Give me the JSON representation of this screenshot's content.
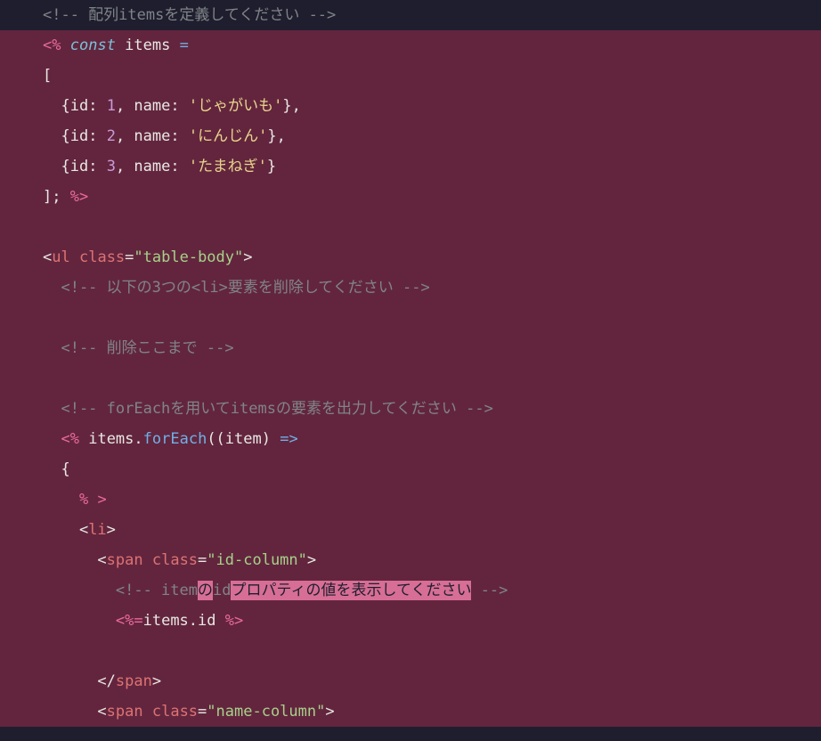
{
  "lines": [
    {
      "hl": false,
      "parts": [
        {
          "c": "tok-comment",
          "t": "<!-- 配列itemsを定義してください -->"
        }
      ]
    },
    {
      "hl": true,
      "parts": [
        {
          "c": "tok-delim",
          "t": "<%"
        },
        {
          "c": "tok-plain",
          "t": " "
        },
        {
          "c": "tok-keyword",
          "t": "const"
        },
        {
          "c": "tok-plain",
          "t": " "
        },
        {
          "c": "tok-var",
          "t": "items"
        },
        {
          "c": "tok-plain",
          "t": " "
        },
        {
          "c": "tok-blue",
          "t": "="
        }
      ]
    },
    {
      "hl": true,
      "parts": [
        {
          "c": "tok-plain",
          "t": "["
        }
      ]
    },
    {
      "hl": true,
      "parts": [
        {
          "c": "tok-plain",
          "t": "  {"
        },
        {
          "c": "tok-attr",
          "t": "id"
        },
        {
          "c": "tok-plain",
          "t": ": "
        },
        {
          "c": "tok-number",
          "t": "1"
        },
        {
          "c": "tok-plain",
          "t": ", "
        },
        {
          "c": "tok-attr",
          "t": "name"
        },
        {
          "c": "tok-plain",
          "t": ": "
        },
        {
          "c": "tok-string",
          "t": "'じゃがいも'"
        },
        {
          "c": "tok-plain",
          "t": "},"
        }
      ]
    },
    {
      "hl": true,
      "parts": [
        {
          "c": "tok-plain",
          "t": "  {"
        },
        {
          "c": "tok-attr",
          "t": "id"
        },
        {
          "c": "tok-plain",
          "t": ": "
        },
        {
          "c": "tok-number",
          "t": "2"
        },
        {
          "c": "tok-plain",
          "t": ", "
        },
        {
          "c": "tok-attr",
          "t": "name"
        },
        {
          "c": "tok-plain",
          "t": ": "
        },
        {
          "c": "tok-string",
          "t": "'にんじん'"
        },
        {
          "c": "tok-plain",
          "t": "},"
        }
      ]
    },
    {
      "hl": true,
      "parts": [
        {
          "c": "tok-plain",
          "t": "  {"
        },
        {
          "c": "tok-attr",
          "t": "id"
        },
        {
          "c": "tok-plain",
          "t": ": "
        },
        {
          "c": "tok-number",
          "t": "3"
        },
        {
          "c": "tok-plain",
          "t": ", "
        },
        {
          "c": "tok-attr",
          "t": "name"
        },
        {
          "c": "tok-plain",
          "t": ": "
        },
        {
          "c": "tok-string",
          "t": "'たまねぎ'"
        },
        {
          "c": "tok-plain",
          "t": "}"
        }
      ]
    },
    {
      "hl": true,
      "parts": [
        {
          "c": "tok-plain",
          "t": "]; "
        },
        {
          "c": "tok-delim",
          "t": "%>"
        }
      ]
    },
    {
      "hl": true,
      "parts": []
    },
    {
      "hl": true,
      "parts": [
        {
          "c": "tok-plain",
          "t": "<"
        },
        {
          "c": "tok-tag",
          "t": "ul"
        },
        {
          "c": "tok-plain",
          "t": " "
        },
        {
          "c": "tok-attrname",
          "t": "class"
        },
        {
          "c": "tok-plain",
          "t": "="
        },
        {
          "c": "tok-attrval",
          "t": "\"table-body\""
        },
        {
          "c": "tok-plain",
          "t": ">"
        }
      ]
    },
    {
      "hl": true,
      "parts": [
        {
          "c": "tok-comment",
          "t": "  <!-- 以下の3つの<li>要素を削除してください -->"
        }
      ]
    },
    {
      "hl": true,
      "parts": []
    },
    {
      "hl": true,
      "parts": [
        {
          "c": "tok-comment",
          "t": "  <!-- 削除ここまで -->"
        }
      ]
    },
    {
      "hl": true,
      "parts": []
    },
    {
      "hl": true,
      "parts": [
        {
          "c": "tok-comment",
          "t": "  <!-- forEachを用いてitemsの要素を出力してください -->"
        }
      ]
    },
    {
      "hl": true,
      "parts": [
        {
          "c": "tok-plain",
          "t": "  "
        },
        {
          "c": "tok-delim",
          "t": "<%"
        },
        {
          "c": "tok-plain",
          "t": " "
        },
        {
          "c": "tok-var",
          "t": "items"
        },
        {
          "c": "tok-plain",
          "t": "."
        },
        {
          "c": "tok-blue",
          "t": "forEach"
        },
        {
          "c": "tok-plain",
          "t": "(("
        },
        {
          "c": "tok-var",
          "t": "item"
        },
        {
          "c": "tok-plain",
          "t": ") "
        },
        {
          "c": "tok-blue",
          "t": "=>"
        }
      ]
    },
    {
      "hl": true,
      "parts": [
        {
          "c": "tok-plain",
          "t": "  {"
        }
      ]
    },
    {
      "hl": true,
      "parts": [
        {
          "c": "tok-plain",
          "t": "    "
        },
        {
          "c": "tok-delim",
          "t": "%"
        },
        {
          "c": "tok-plain",
          "t": " "
        },
        {
          "c": "tok-delim",
          "t": ">"
        }
      ]
    },
    {
      "hl": true,
      "parts": [
        {
          "c": "tok-plain",
          "t": "    <"
        },
        {
          "c": "tok-tag",
          "t": "li"
        },
        {
          "c": "tok-plain",
          "t": ">"
        }
      ]
    },
    {
      "hl": true,
      "parts": [
        {
          "c": "tok-plain",
          "t": "      <"
        },
        {
          "c": "tok-tag",
          "t": "span"
        },
        {
          "c": "tok-plain",
          "t": " "
        },
        {
          "c": "tok-attrname",
          "t": "class"
        },
        {
          "c": "tok-plain",
          "t": "="
        },
        {
          "c": "tok-attrval",
          "t": "\"id-column\""
        },
        {
          "c": "tok-plain",
          "t": ">"
        }
      ]
    },
    {
      "hl": true,
      "parts": [
        {
          "c": "tok-comment",
          "t": "        <!-- item"
        },
        {
          "c": "pink-hl",
          "t": "の"
        },
        {
          "c": "tok-comment",
          "t": "id"
        },
        {
          "c": "pink-hl",
          "t": "プロパティの値を表示してください"
        },
        {
          "c": "tok-comment",
          "t": " -->"
        }
      ]
    },
    {
      "hl": true,
      "parts": [
        {
          "c": "tok-plain",
          "t": "        "
        },
        {
          "c": "tok-delim",
          "t": "<%="
        },
        {
          "c": "tok-var",
          "t": "items"
        },
        {
          "c": "tok-plain",
          "t": "."
        },
        {
          "c": "tok-var",
          "t": "id"
        },
        {
          "c": "tok-plain",
          "t": " "
        },
        {
          "c": "tok-delim",
          "t": "%>"
        }
      ]
    },
    {
      "hl": true,
      "parts": []
    },
    {
      "hl": true,
      "parts": [
        {
          "c": "tok-plain",
          "t": "      </"
        },
        {
          "c": "tok-tag",
          "t": "span"
        },
        {
          "c": "tok-plain",
          "t": ">"
        }
      ]
    },
    {
      "hl": true,
      "parts": [
        {
          "c": "tok-plain",
          "t": "      <"
        },
        {
          "c": "tok-tag",
          "t": "span"
        },
        {
          "c": "tok-plain",
          "t": " "
        },
        {
          "c": "tok-attrname",
          "t": "class"
        },
        {
          "c": "tok-plain",
          "t": "="
        },
        {
          "c": "tok-attrval",
          "t": "\"name-column\""
        },
        {
          "c": "tok-plain",
          "t": ">"
        }
      ]
    }
  ]
}
